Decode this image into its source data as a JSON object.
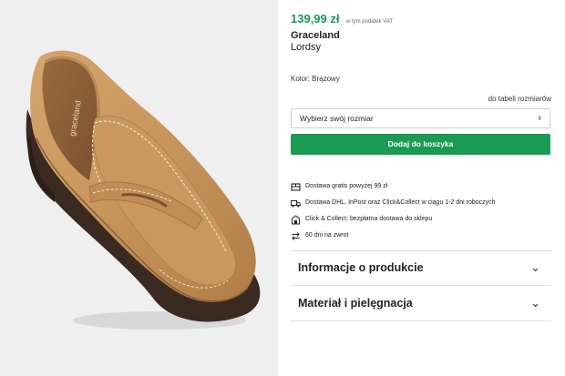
{
  "product": {
    "price": "139,99 zł",
    "vat_note": "w tym podatek VAT",
    "brand": "Graceland",
    "model": "Lordsy",
    "color_label": "Kolor:",
    "color_value": "Brązowy",
    "size_table_link": "do tabeli rozmiarów",
    "size_select_placeholder": "Wybierz swój rozmiar",
    "add_to_cart": "Dodaj do koszyka",
    "insole_print": "graceland"
  },
  "features": [
    {
      "icon": "package-icon",
      "text": "Dostawa gratis powyżej 99 zł"
    },
    {
      "icon": "truck-icon",
      "text": "Dostawa DHL, InPost oraz Click&Collect w ciągu 1-2 dni roboczych"
    },
    {
      "icon": "store-icon",
      "text": "Click & Collect: bezpłatna dostawa do sklepu"
    },
    {
      "icon": "return-arrows-icon",
      "text": "60 dni na zwrot"
    }
  ],
  "accordions": [
    {
      "title": "Informacje o produkcie"
    },
    {
      "title": "Materiał i pielęgnacja"
    }
  ],
  "colors": {
    "accent": "#1a9a52",
    "shoe_suede": "#c8975e",
    "sole": "#3b2a22",
    "background_image": "#efefef"
  }
}
